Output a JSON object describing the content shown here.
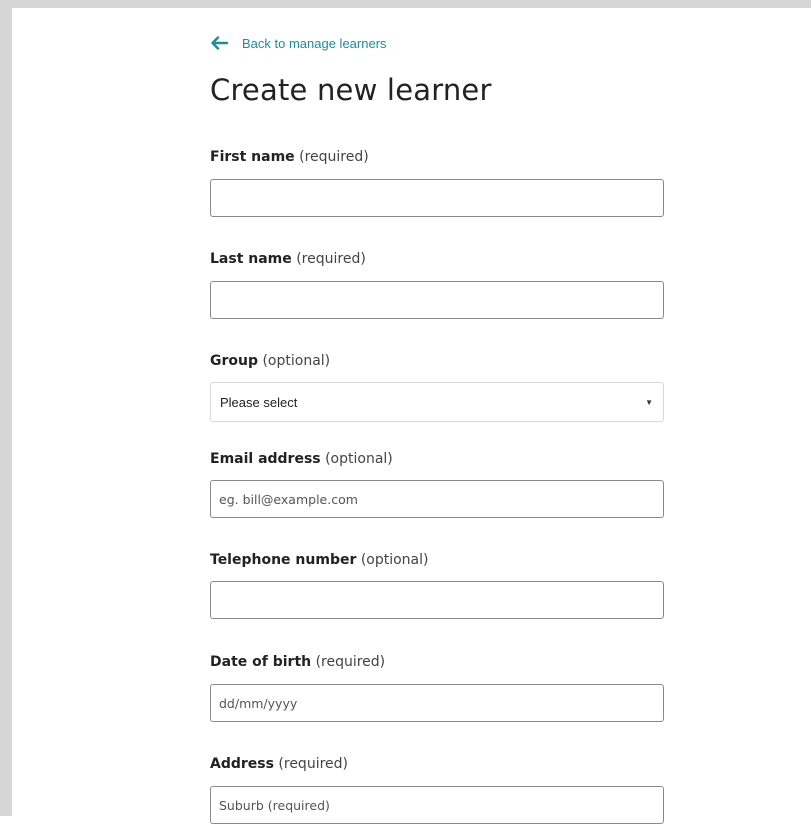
{
  "back_link": {
    "label": "Back to manage learners"
  },
  "page_title": "Create new learner",
  "fields": {
    "first_name": {
      "label": "First name",
      "hint": "(required)",
      "value": "",
      "placeholder": ""
    },
    "last_name": {
      "label": "Last name",
      "hint": "(required)",
      "value": "",
      "placeholder": ""
    },
    "group": {
      "label": "Group",
      "hint": "(optional)",
      "selected": "Please select"
    },
    "email": {
      "label": "Email address",
      "hint": "(optional)",
      "value": "",
      "placeholder": "eg. bill@example.com"
    },
    "telephone": {
      "label": "Telephone number",
      "hint": "(optional)",
      "value": "",
      "placeholder": ""
    },
    "dob": {
      "label": "Date of birth",
      "hint": "(required)",
      "value": "",
      "placeholder": "dd/mm/yyyy"
    },
    "address": {
      "label": "Address",
      "hint": "(required)",
      "value": "",
      "placeholder": "Suburb (required)"
    }
  },
  "colors": {
    "link": "#1f8c96",
    "frame": "#d6d6d6",
    "text": "#222222"
  },
  "icons": {
    "back": "arrow-left-icon",
    "select": "caret-down-icon"
  }
}
